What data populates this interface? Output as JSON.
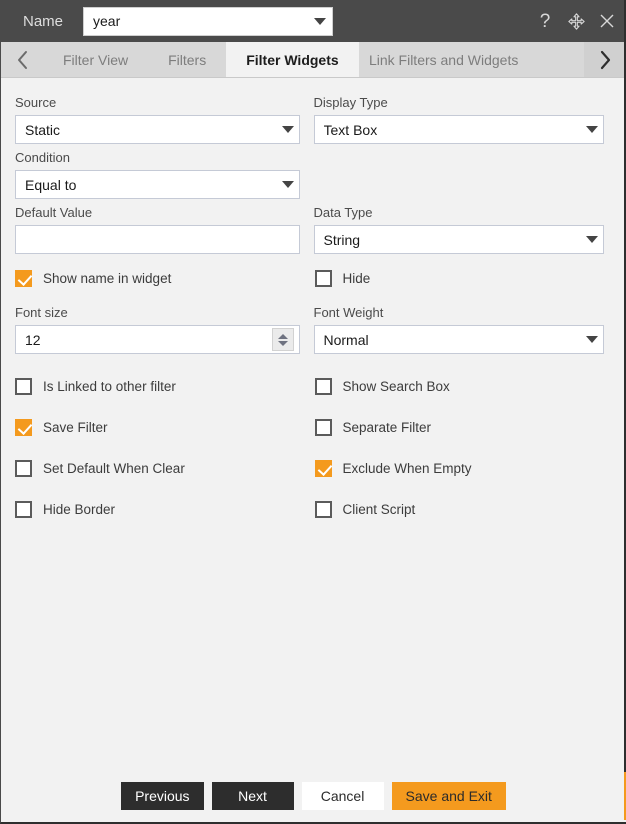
{
  "titlebar": {
    "name_label": "Name",
    "name_value": "year",
    "help_icon": "question-mark-icon",
    "move_icon": "move-four-arrows-icon",
    "close_icon": "close-icon"
  },
  "tabs": {
    "prev_arrow": "chevron-left-icon",
    "next_arrow": "chevron-right-icon",
    "items": [
      {
        "label": "Filter View",
        "active": false
      },
      {
        "label": "Filters",
        "active": false
      },
      {
        "label": "Filter Widgets",
        "active": true
      },
      {
        "label": "Link Filters and Widgets",
        "active": false
      }
    ]
  },
  "form": {
    "source": {
      "label": "Source",
      "value": "Static"
    },
    "display_type": {
      "label": "Display Type",
      "value": "Text Box"
    },
    "condition": {
      "label": "Condition",
      "value": "Equal to"
    },
    "default_value": {
      "label": "Default Value",
      "value": ""
    },
    "data_type": {
      "label": "Data Type",
      "value": "String"
    },
    "font_size": {
      "label": "Font size",
      "value": "12"
    },
    "font_weight": {
      "label": "Font Weight",
      "value": "Normal"
    }
  },
  "checkboxes": {
    "show_name_in_widget": {
      "label": "Show name in widget",
      "checked": true
    },
    "hide": {
      "label": "Hide",
      "checked": false
    },
    "is_linked_to_other_filter": {
      "label": "Is Linked to other filter",
      "checked": false
    },
    "show_search_box": {
      "label": "Show Search Box",
      "checked": false
    },
    "save_filter": {
      "label": "Save Filter",
      "checked": true
    },
    "separate_filter": {
      "label": "Separate Filter",
      "checked": false
    },
    "set_default_when_clear": {
      "label": "Set Default When Clear",
      "checked": false
    },
    "exclude_when_empty": {
      "label": "Exclude When Empty",
      "checked": true
    },
    "hide_border": {
      "label": "Hide Border",
      "checked": false
    },
    "client_script": {
      "label": "Client Script",
      "checked": false
    }
  },
  "footer": {
    "previous": "Previous",
    "next": "Next",
    "cancel": "Cancel",
    "save_and_exit": "Save and Exit"
  },
  "colors": {
    "accent": "#f49a1e",
    "titlebar": "#4a4a4a",
    "background": "#f2f2f2",
    "tab_inactive": "#d8d8d8"
  }
}
